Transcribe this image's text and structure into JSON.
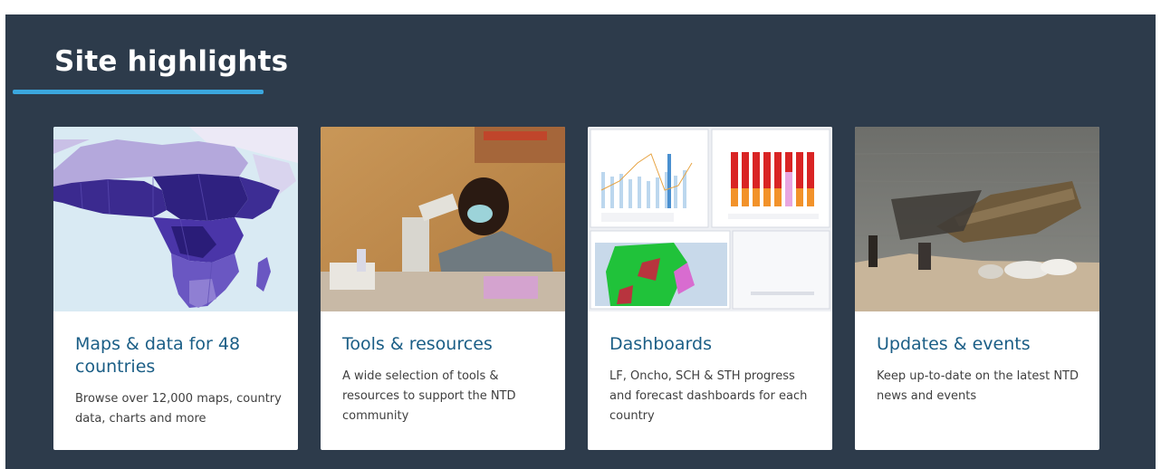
{
  "section": {
    "title": "Site highlights",
    "accent_color": "#3ba7de",
    "background_color": "#2d3b4b"
  },
  "cards": [
    {
      "title": "Maps & data for 48 countries",
      "description": "Browse over 12,000 maps, country data, charts and more",
      "image": "africa-map-image"
    },
    {
      "title": "Tools & resources",
      "description": "A wide selection of tools & resources to support the NTD community",
      "image": "lab-microscope-photo"
    },
    {
      "title": "Dashboards",
      "description": "LF, Oncho, SCH & STH progress and forecast dashboards for each country",
      "image": "dashboard-screenshot"
    },
    {
      "title": "Updates & events",
      "description": "Keep up-to-date on the latest NTD news and events",
      "image": "boat-lakeshore-photo"
    }
  ]
}
